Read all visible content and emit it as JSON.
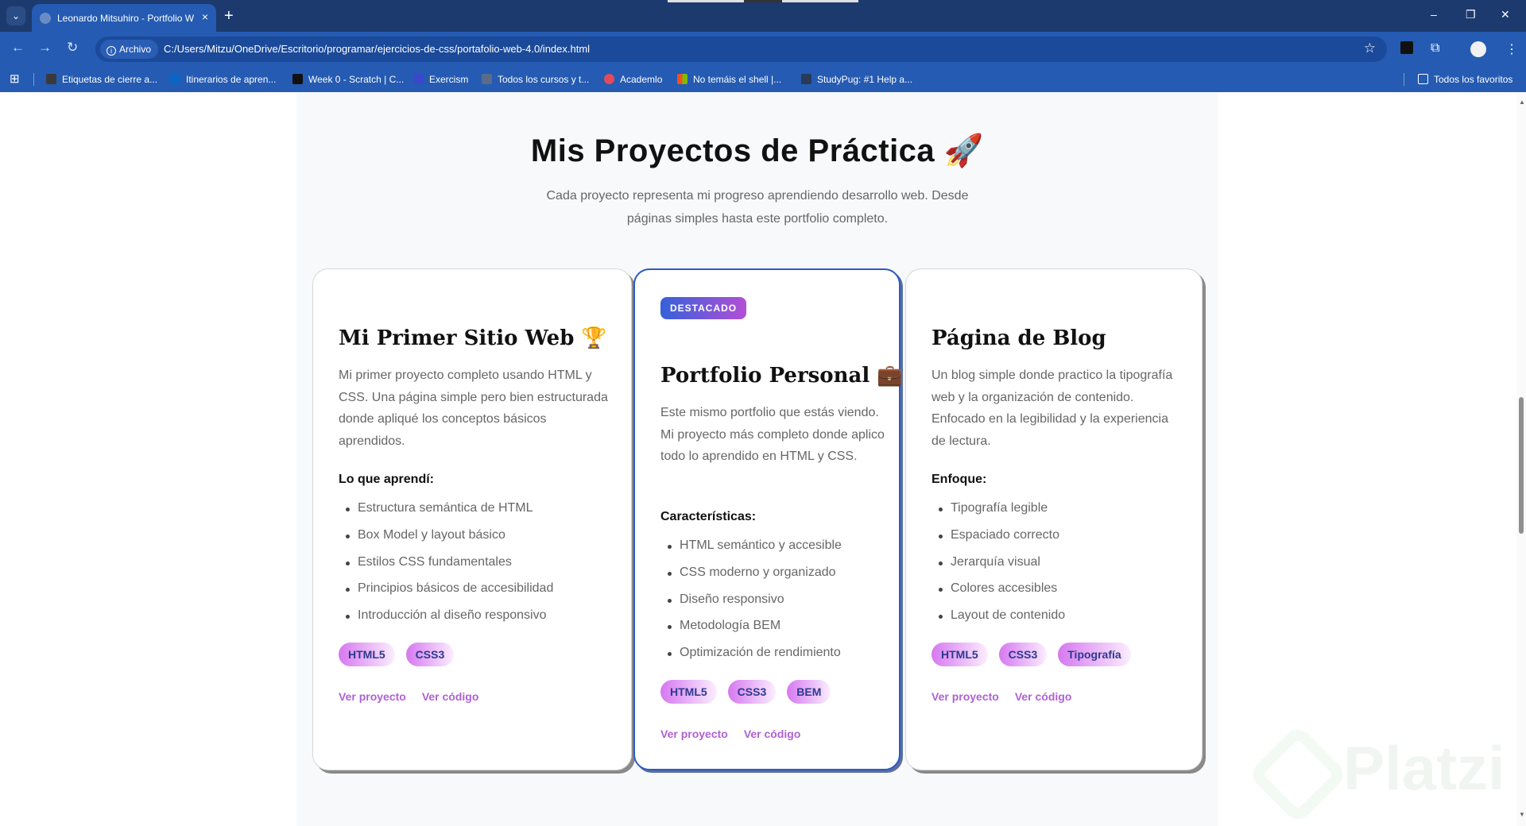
{
  "browser": {
    "tab_title": "Leonardo Mitsuhiro - Portfolio W",
    "tab_close": "×",
    "new_tab": "+",
    "dropdown": "⌄",
    "window_minimize": "–",
    "window_restore": "❐",
    "window_close": "✕",
    "back": "←",
    "forward": "→",
    "reload": "↻",
    "chip_label": "Archivo",
    "url": "C:/Users/Mitzu/OneDrive/Escritorio/programar/ejercicios-de-css/portafolio-web-4.0/index.html",
    "star": "☆",
    "extension_icon": "⧉",
    "menu_icon": "⋮",
    "apps_icon": "⊞"
  },
  "bookmarks": [
    {
      "label": "Etiquetas de cierre a...",
      "color": "#3a3a3a"
    },
    {
      "label": "Itinerarios de apren...",
      "color": "#0a66c2"
    },
    {
      "label": "Week 0 - Scratch | C...",
      "color": "#111111"
    },
    {
      "label": "Exercism",
      "color": "#3b48cc"
    },
    {
      "label": "Todos los cursos y t...",
      "color": "#5a6b8c"
    },
    {
      "label": "Academlo",
      "color": "#e34b5c"
    },
    {
      "label": "No temáis el shell |...",
      "color": "#f25022"
    },
    {
      "label": "StudyPug: #1 Help a...",
      "color": "#2a3a5a"
    }
  ],
  "favorites_label": "Todos los favoritos",
  "section": {
    "title": "Mis Proyectos de Práctica 🚀",
    "subtitle": "Cada proyecto representa mi progreso aprendiendo desarrollo web. Desde páginas simples hasta este portfolio completo."
  },
  "cards": [
    {
      "title": "Mi Primer Sitio Web 🏆",
      "description": "Mi primer proyecto completo usando HTML y CSS. Una página simple pero bien estructurada donde apliqué los conceptos básicos aprendidos.",
      "list_heading": "Lo que aprendí:",
      "items": [
        "Estructura semántica de HTML",
        "Box Model y layout básico",
        "Estilos CSS fundamentales",
        "Principios básicos de accesibilidad",
        "Introducción al diseño responsivo"
      ],
      "tags": [
        "HTML5",
        "CSS3"
      ],
      "links": [
        "Ver proyecto",
        "Ver código"
      ]
    },
    {
      "badge": "DESTACADO",
      "title": "Portfolio Personal 💼",
      "description": "Este mismo portfolio que estás viendo. Mi proyecto más completo donde aplico todo lo aprendido en HTML y CSS.",
      "list_heading": "Características:",
      "items": [
        "HTML semántico y accesible",
        "CSS moderno y organizado",
        "Diseño responsivo",
        "Metodología BEM",
        "Optimización de rendimiento"
      ],
      "tags": [
        "HTML5",
        "CSS3",
        "BEM"
      ],
      "links": [
        "Ver proyecto",
        "Ver código"
      ]
    },
    {
      "title": "Página de Blog",
      "description": "Un blog simple donde practico la tipografía web y la organización de contenido. Enfocado en la legibilidad y la experiencia de lectura.",
      "list_heading": "Enfoque:",
      "items": [
        "Tipografía legible",
        "Espaciado correcto",
        "Jerarquía visual",
        "Colores accesibles",
        "Layout de contenido"
      ],
      "tags": [
        "HTML5",
        "CSS3",
        "Tipografía"
      ],
      "links": [
        "Ver proyecto",
        "Ver código"
      ]
    }
  ],
  "watermark": "Platzi",
  "colors": {
    "accent": "#2b5bc4",
    "link": "#b061d4",
    "tag_text": "#2c3a8f"
  }
}
